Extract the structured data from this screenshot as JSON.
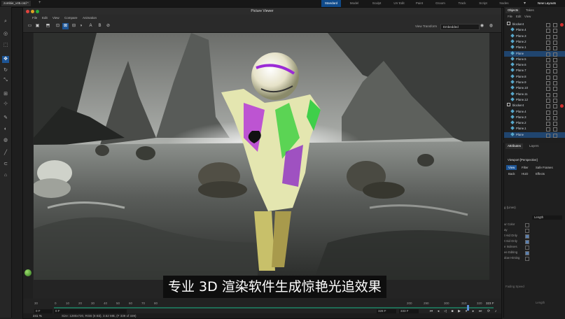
{
  "top_bar": {
    "document_tab": "zombie_v45.c4d *",
    "add_tab": "+",
    "layouts": [
      "Standard",
      "Model",
      "Sculpt",
      "UV Edit",
      "Paint",
      "Groom",
      "Track",
      "Script",
      "Nodes"
    ],
    "active_layout": "Standard",
    "new_layouts": "New Layouts"
  },
  "picture_viewer": {
    "title": "Picture Viewer",
    "menu": [
      "File",
      "Edit",
      "View",
      "Compare",
      "Animation"
    ],
    "view_transform_label": "View Transform",
    "view_transform_value": "Embedded",
    "toolbar_letters": [
      "A",
      "B"
    ]
  },
  "subtitle": "专业 3D 渲染软件生成惊艳光追效果",
  "timeline": {
    "ticks": [
      "0",
      "10",
      "20",
      "30",
      "40",
      "50",
      "60",
      "70",
      "80",
      "200",
      "290",
      "300",
      "310",
      "320"
    ],
    "start_field": "30",
    "end_field": "323 F",
    "current_frame": "0 F",
    "range_start": "0 F",
    "range_end": "328 F",
    "max_frame": "333 F",
    "zoom": "241 %",
    "status": "Size: 1280x720, RGB (8 Bit), 3.52 MB, (F 339 of 339)"
  },
  "objects_panel": {
    "tabs": [
      "Objects",
      "Takes"
    ],
    "menu": [
      "File",
      "Edit",
      "View"
    ],
    "rows": [
      {
        "name": "blocker4",
        "type": "null",
        "selected": false,
        "red": true
      },
      {
        "name": "Plane.4",
        "type": "plane",
        "selected": false,
        "red": false
      },
      {
        "name": "Plane.3",
        "type": "plane",
        "selected": false,
        "red": false
      },
      {
        "name": "Plane.2",
        "type": "plane",
        "selected": false,
        "red": false
      },
      {
        "name": "Plane.1",
        "type": "plane",
        "selected": false,
        "red": false
      },
      {
        "name": "Plane",
        "type": "plane",
        "selected": true,
        "red": false
      },
      {
        "name": "Plane.5",
        "type": "plane",
        "selected": false,
        "red": false
      },
      {
        "name": "Plane.6",
        "type": "plane",
        "selected": false,
        "red": false
      },
      {
        "name": "Plane.7",
        "type": "plane",
        "selected": false,
        "red": false
      },
      {
        "name": "Plane.8",
        "type": "plane",
        "selected": false,
        "red": false
      },
      {
        "name": "Plane.9",
        "type": "plane",
        "selected": false,
        "red": false
      },
      {
        "name": "Plane.10",
        "type": "plane",
        "selected": false,
        "red": false
      },
      {
        "name": "Plane.11",
        "type": "plane",
        "selected": false,
        "red": false
      },
      {
        "name": "Plane.12",
        "type": "plane",
        "selected": false,
        "red": false
      },
      {
        "name": "blocker4",
        "type": "null",
        "selected": false,
        "red": true
      },
      {
        "name": "Plane.4",
        "type": "plane",
        "selected": false,
        "red": false
      },
      {
        "name": "Plane.3",
        "type": "plane",
        "selected": false,
        "red": false
      },
      {
        "name": "Plane.2",
        "type": "plane",
        "selected": false,
        "red": false
      },
      {
        "name": "Plane.1",
        "type": "plane",
        "selected": false,
        "red": false
      },
      {
        "name": "Plane",
        "type": "plane",
        "selected": true,
        "red": false
      }
    ]
  },
  "attributes_panel": {
    "tabs": [
      "Attributes",
      "Layers"
    ],
    "viewport_label": "Viewport [Perspective]",
    "buttons_row1": [
      "View",
      "Filter",
      "Safe Frames"
    ],
    "buttons_row2": [
      "Back",
      "HUD",
      "Effects"
    ],
    "length_label": "Length",
    "lines_label": "g (Lines)",
    "rows": [
      {
        "label": "ur Color",
        "checked": false
      },
      {
        "label": "ay",
        "checked": false
      },
      {
        "label": "t Hid Only",
        "checked": true
      },
      {
        "label": "t Hid Only",
        "checked": true
      },
      {
        "label": "e Indexes",
        "checked": false
      },
      {
        "label": "ee Editing",
        "checked": true
      },
      {
        "label": "dow Hinting",
        "checked": false
      }
    ],
    "footer_left": "Fading Speed",
    "footer_right": "Length"
  }
}
